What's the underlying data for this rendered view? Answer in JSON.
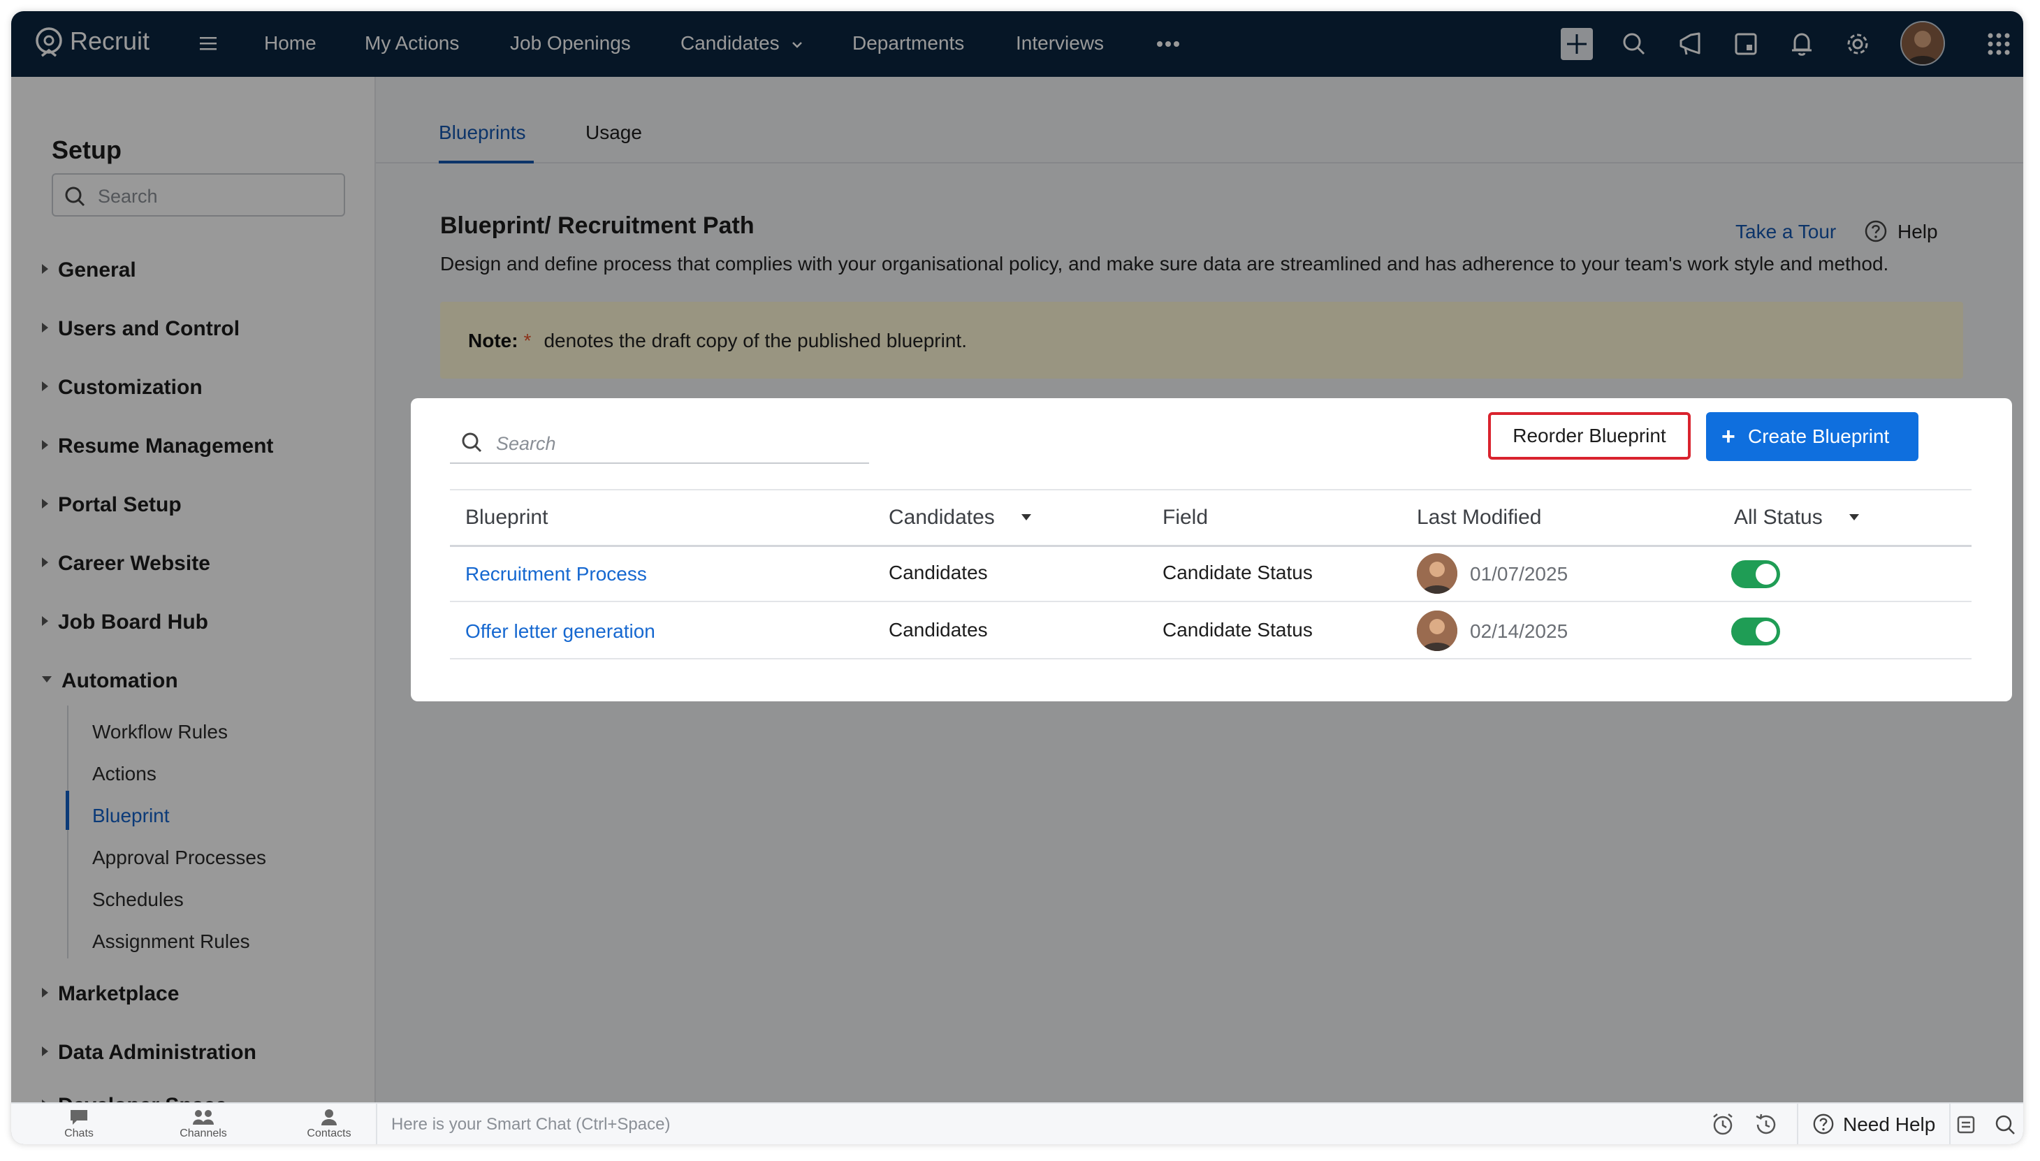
{
  "app": {
    "name": "Recruit"
  },
  "nav": {
    "items": [
      "Home",
      "My Actions",
      "Job Openings",
      "Candidates",
      "Departments",
      "Interviews"
    ]
  },
  "sidebar": {
    "title": "Setup",
    "search_placeholder": "Search",
    "sections": [
      "General",
      "Users and Control",
      "Customization",
      "Resume Management",
      "Portal Setup",
      "Career Website",
      "Job Board Hub",
      "Automation"
    ],
    "automation_items": [
      "Workflow Rules",
      "Actions",
      "Blueprint",
      "Approval Processes",
      "Schedules",
      "Assignment Rules"
    ],
    "active_item": "Blueprint",
    "sections_after": [
      "Marketplace",
      "Data Administration",
      "Developer Space"
    ]
  },
  "tabs": [
    "Blueprints",
    "Usage"
  ],
  "page": {
    "title": "Blueprint/ Recruitment Path",
    "take_tour": "Take a Tour",
    "help": "Help",
    "description": "Design and define process that complies with your organisational policy, and make sure data are streamlined and has adherence to your team's work style and method.",
    "note_label": "Note:",
    "note_star": "*",
    "note_text": "denotes the draft copy of the published blueprint."
  },
  "table": {
    "search_placeholder": "Search",
    "reorder_label": "Reorder Blueprint",
    "create_label": "Create Blueprint",
    "columns": {
      "blueprint": "Blueprint",
      "candidates": "Candidates",
      "field": "Field",
      "last_modified": "Last Modified",
      "status": "All Status"
    },
    "rows": [
      {
        "name": "Recruitment Process",
        "module": "Candidates",
        "field": "Candidate Status",
        "modified": "01/07/2025",
        "enabled": true
      },
      {
        "name": "Offer letter generation",
        "module": "Candidates",
        "field": "Candidate Status",
        "modified": "02/14/2025",
        "enabled": true
      }
    ]
  },
  "bottombar": {
    "chats": "Chats",
    "channels": "Channels",
    "contacts": "Contacts",
    "smart_chat": "Here is your Smart Chat (Ctrl+Space)",
    "need_help": "Need Help"
  },
  "colors": {
    "topbar": "#0a2540",
    "accent": "#0f6fde",
    "link": "#1668d0",
    "highlight_border": "#d9232e",
    "toggle_on": "#1f9d55",
    "note_bg": "#fff9d8"
  }
}
